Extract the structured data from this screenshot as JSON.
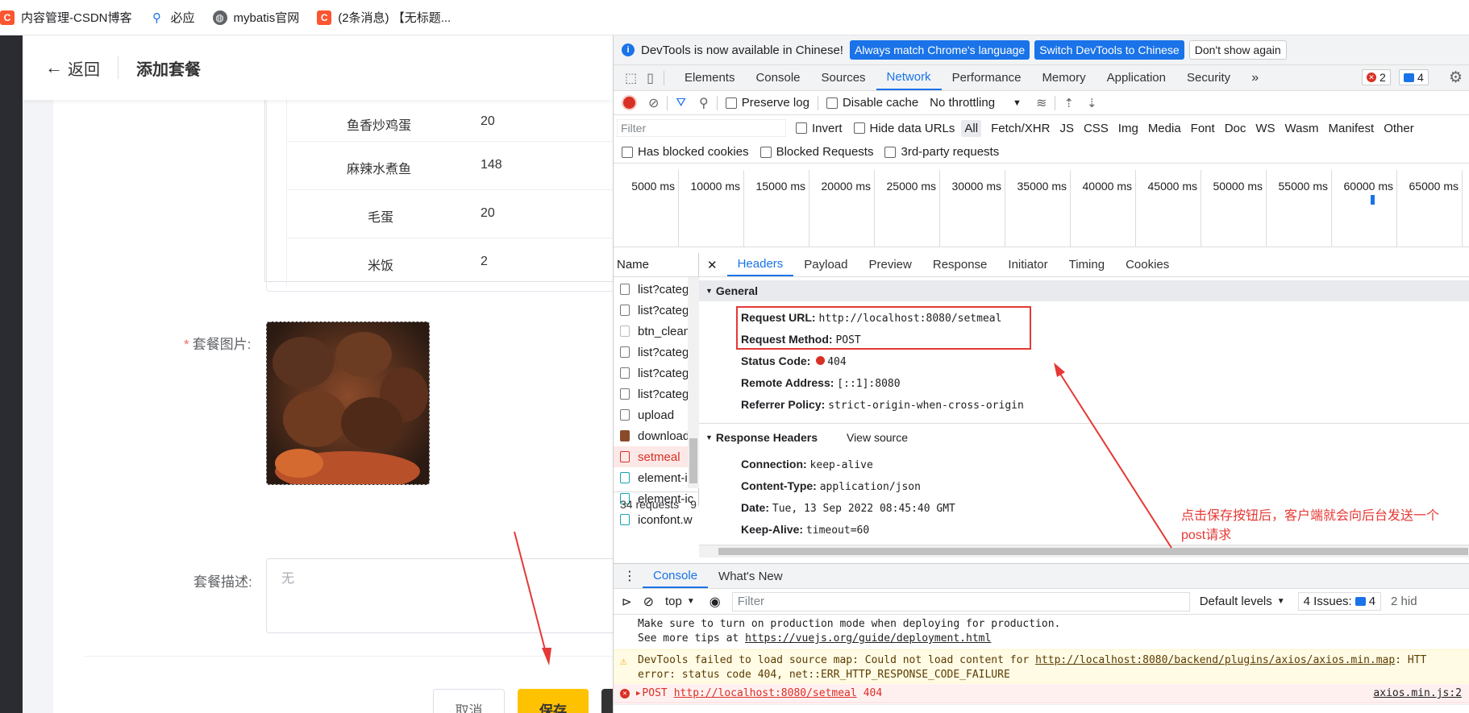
{
  "bookmarks": [
    {
      "label": "内容管理-CSDN博客",
      "icon": "csdn-icon"
    },
    {
      "label": "必应",
      "icon": "bing-search-icon"
    },
    {
      "label": "mybatis官网",
      "icon": "globe-icon"
    },
    {
      "label": "(2条消息) 【无标题...",
      "icon": "csdn-icon"
    }
  ],
  "app": {
    "back_label": "返回",
    "page_title": "添加套餐",
    "dishes": [
      {
        "name": "鱼香炒鸡蛋",
        "price": "20"
      },
      {
        "name": "麻辣水煮鱼",
        "price": "148"
      },
      {
        "name": "毛蛋",
        "price": "20"
      },
      {
        "name": "米饭",
        "price": "2"
      }
    ],
    "image_label": "套餐图片:",
    "required_mark": "*",
    "desc_label": "套餐描述:",
    "desc_placeholder": "无",
    "cancel_label": "取消",
    "save_label": "保存"
  },
  "devtools": {
    "banner_text": "DevTools is now available in Chinese!",
    "banner_btn1": "Always match Chrome's language",
    "banner_btn2": "Switch DevTools to Chinese",
    "banner_btn3": "Don't show again",
    "tabs": [
      "Elements",
      "Console",
      "Sources",
      "Network",
      "Performance",
      "Memory",
      "Application",
      "Security"
    ],
    "active_tab": "Network",
    "more": "»",
    "error_count": "2",
    "issue_count": "4",
    "preserve_log": "Preserve log",
    "disable_cache": "Disable cache",
    "throttling": "No throttling",
    "filter_placeholder": "Filter",
    "invert": "Invert",
    "hide_data_urls": "Hide data URLs",
    "types": [
      "All",
      "Fetch/XHR",
      "JS",
      "CSS",
      "Img",
      "Media",
      "Font",
      "Doc",
      "WS",
      "Wasm",
      "Manifest",
      "Other"
    ],
    "has_blocked_cookies": "Has blocked cookies",
    "blocked_requests": "Blocked Requests",
    "third_party": "3rd-party requests",
    "timeline_ticks": [
      "5000 ms",
      "10000 ms",
      "15000 ms",
      "20000 ms",
      "25000 ms",
      "30000 ms",
      "35000 ms",
      "40000 ms",
      "45000 ms",
      "50000 ms",
      "55000 ms",
      "60000 ms",
      "65000 ms"
    ],
    "name_header": "Name",
    "requests": [
      {
        "name": "list?catego",
        "kind": "doc"
      },
      {
        "name": "list?catego",
        "kind": "doc"
      },
      {
        "name": "btn_clean..",
        "kind": "img"
      },
      {
        "name": "list?catego",
        "kind": "doc"
      },
      {
        "name": "list?catego",
        "kind": "doc"
      },
      {
        "name": "list?catego",
        "kind": "doc"
      },
      {
        "name": "upload",
        "kind": "doc"
      },
      {
        "name": "download?",
        "kind": "image"
      },
      {
        "name": "setmeal",
        "kind": "error"
      },
      {
        "name": "element-ic",
        "kind": "font"
      },
      {
        "name": "element-ic",
        "kind": "font"
      },
      {
        "name": "iconfont.w",
        "kind": "font"
      }
    ],
    "request_count": "34 requests",
    "request_count_tail": "9",
    "detail_tabs": [
      "Headers",
      "Payload",
      "Preview",
      "Response",
      "Initiator",
      "Timing",
      "Cookies"
    ],
    "general_title": "General",
    "general": [
      {
        "k": "Request URL:",
        "v": "http://localhost:8080/setmeal"
      },
      {
        "k": "Request Method:",
        "v": "POST"
      },
      {
        "k": "Status Code:",
        "v": "404"
      },
      {
        "k": "Remote Address:",
        "v": "[::1]:8080"
      },
      {
        "k": "Referrer Policy:",
        "v": "strict-origin-when-cross-origin"
      }
    ],
    "response_headers_title": "Response Headers",
    "view_source": "View source",
    "response_headers": [
      {
        "k": "Connection:",
        "v": "keep-alive"
      },
      {
        "k": "Content-Type:",
        "v": "application/json"
      },
      {
        "k": "Date:",
        "v": "Tue, 13 Sep 2022 08:45:40 GMT"
      },
      {
        "k": "Keep-Alive:",
        "v": "timeout=60"
      }
    ],
    "annotation": "点击保存按钮后，客户端就会向后台发送一个post请求",
    "console_tabs": [
      "Console",
      "What's New"
    ],
    "context": "top",
    "console_filter": "Filter",
    "default_levels": "Default levels",
    "issues_label": "4 Issues:",
    "issues_num": "4",
    "hidden": "2 hid",
    "log1": "Make sure to turn on production mode when deploying for production.",
    "log2_prefix": "See more tips at ",
    "log2_link": "https://vuejs.org/guide/deployment.html",
    "warn_prefix": "DevTools failed to load source map: Could not load content for ",
    "warn_link": "http://localhost:8080/backend/plugins/axios/axios.min.map",
    "warn_suffix": ": HTT",
    "warn_line2": "error: status code 404, net::ERR_HTTP_RESPONSE_CODE_FAILURE",
    "err_method": "POST",
    "err_url": "http://localhost:8080/setmeal",
    "err_code": "404",
    "err_source": "axios.min.js:2",
    "colors": {
      "accent": "#1a73e8",
      "error": "#d93025",
      "annotation": "#e53935",
      "save": "#ffc200"
    }
  }
}
